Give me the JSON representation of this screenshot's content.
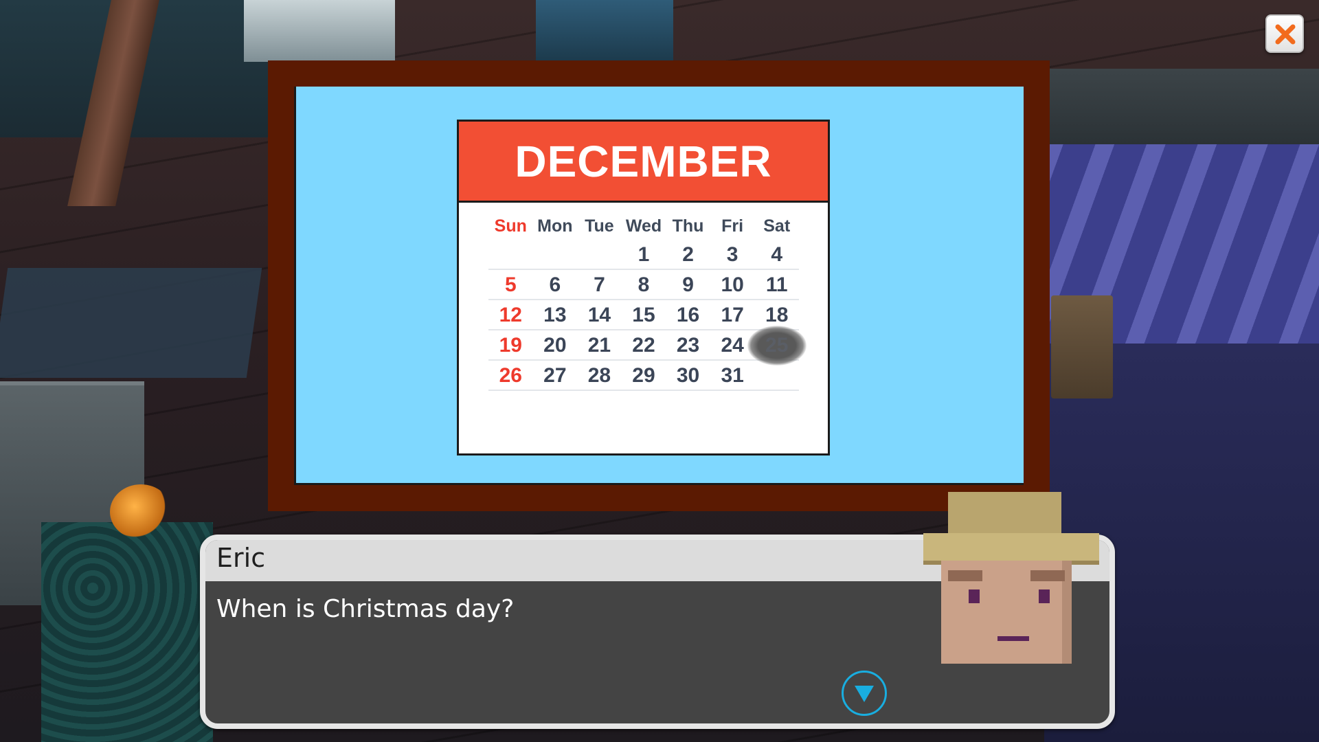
{
  "close_button": {
    "icon": "close-icon",
    "color": "#f26b1d"
  },
  "calendar": {
    "month": "DECEMBER",
    "weekdays": [
      "Sun",
      "Mon",
      "Tue",
      "Wed",
      "Thu",
      "Fri",
      "Sat"
    ],
    "weeks": [
      [
        "",
        "",
        "",
        "1",
        "2",
        "3",
        "4"
      ],
      [
        "5",
        "6",
        "7",
        "8",
        "9",
        "10",
        "11"
      ],
      [
        "12",
        "13",
        "14",
        "15",
        "16",
        "17",
        "18"
      ],
      [
        "19",
        "20",
        "21",
        "22",
        "23",
        "24",
        "25"
      ],
      [
        "26",
        "27",
        "28",
        "29",
        "30",
        "31",
        ""
      ]
    ],
    "smudged_day": "25",
    "header_color": "#f24f34",
    "sunday_color": "#ee3a2c"
  },
  "dialog": {
    "speaker": "Eric",
    "text": "When is Christmas day?",
    "advance_icon": "triangle-down-icon",
    "accent_color": "#19aee0"
  }
}
